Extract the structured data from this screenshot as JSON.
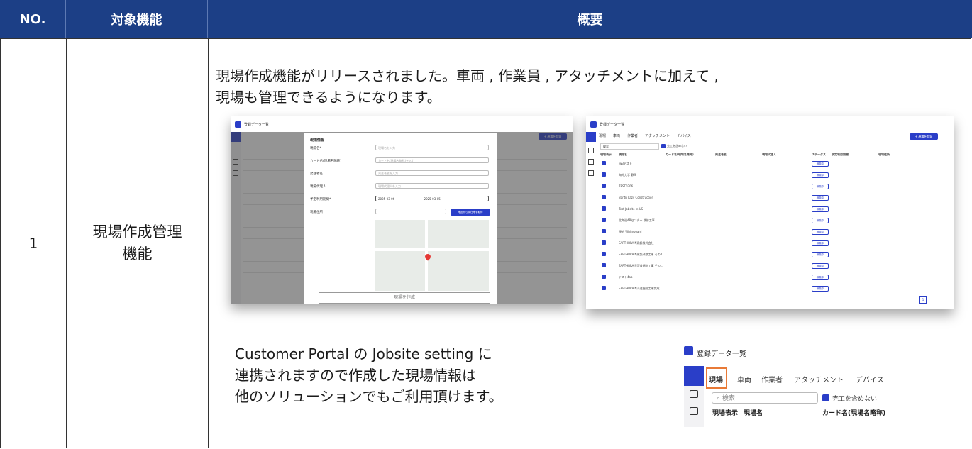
{
  "table": {
    "headers": {
      "no": "NO.",
      "function": "対象機能",
      "summary": "概要"
    },
    "rows": [
      {
        "no": "1",
        "function_line1": "現場作成管理",
        "function_line2": "機能",
        "intro_line1": "現場作成機能がリリースされました。車両 , 作業員 , アタッチメントに加えて ,",
        "intro_line2": "現場も管理できるようになります。",
        "sub_line1": "Customer Portal の Jobsite setting に",
        "sub_line2": "連携されますので作成した現場情報は",
        "sub_line3": "他のソリューションでもご利用頂けます。"
      }
    ]
  },
  "colors": {
    "header_bg": "#1c3f86",
    "accent": "#2a3ec8",
    "highlight": "#e87a37"
  },
  "screenshot_list": {
    "title": "登録データ一覧",
    "tabs": [
      "現場",
      "車両",
      "作業者",
      "アタッチメント",
      "デバイス"
    ],
    "add_button": "+ 現場を登録",
    "search_placeholder": "検索",
    "exclude_completed": "完工を含めない",
    "columns": [
      "現場表示",
      "現場名",
      "カード名(現場名略称)",
      "発注者名",
      "現場代理人",
      "ステータス",
      "予定利用期間",
      "現場住所"
    ],
    "sites": [
      "jw3テスト",
      "海外大学 静岡",
      "TEST0206",
      "Bantu Lazy Construction",
      "Test Jobsite in US",
      "北海道ARセンター 改修工事",
      "現地 Whiteboard",
      "EARTHBRAIN建設株式会社",
      "EARTHBRAIN建設改修工事 その4",
      "EARTHBRAIN河道掘削工事 その...",
      "テスト4ab",
      "EARTHBRAIN河道掘削工事完成"
    ],
    "status": "稼働中",
    "page": "1"
  },
  "screenshot_modal": {
    "title": "現場情報",
    "fields": [
      "現場名*",
      "カード名(現場名略称)",
      "発注者名",
      "現場代理人",
      "予定利用期間*",
      "現場住所"
    ],
    "placeholders": [
      "現場名を入力",
      "カード名(現場名略称)を入力",
      "発注者名を入力",
      "現場代理人を入力"
    ],
    "date_from": "2025-03-06",
    "date_to": "2025-03-05",
    "address_button": "地図から現在地を取得",
    "create_button": "現場を作成"
  }
}
